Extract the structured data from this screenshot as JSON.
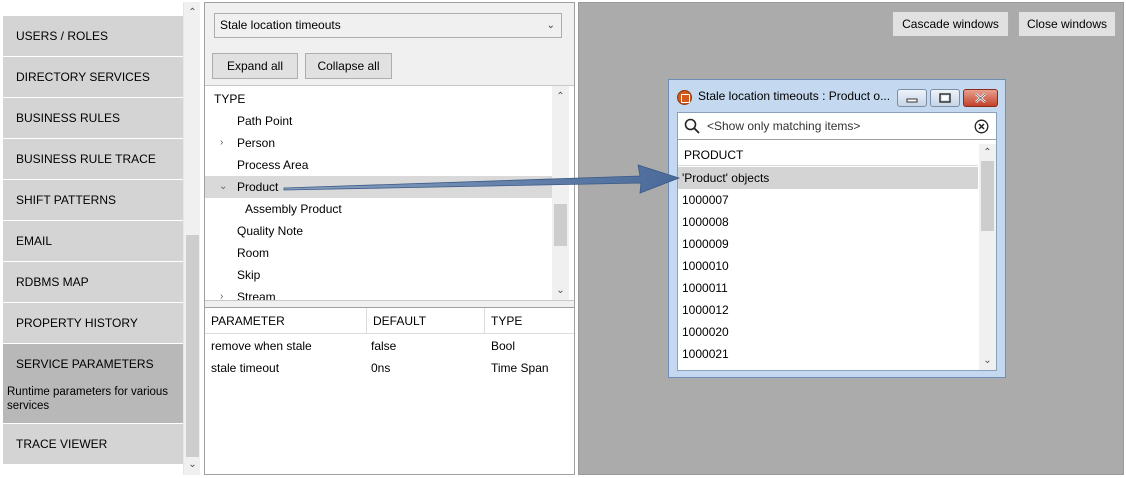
{
  "nav": {
    "items": [
      {
        "label": "USERS / ROLES"
      },
      {
        "label": "DIRECTORY SERVICES"
      },
      {
        "label": "BUSINESS RULES"
      },
      {
        "label": "BUSINESS RULE TRACE"
      },
      {
        "label": "SHIFT PATTERNS"
      },
      {
        "label": "EMAIL"
      },
      {
        "label": "RDBMS MAP"
      },
      {
        "label": "PROPERTY HISTORY"
      },
      {
        "label": "SERVICE PARAMETERS",
        "description": "Runtime parameters for various services"
      },
      {
        "label": "TRACE VIEWER"
      }
    ],
    "selected": "SERVICE PARAMETERS"
  },
  "middle": {
    "combo_value": "Stale location timeouts",
    "expand_all": "Expand all",
    "collapse_all": "Collapse all",
    "tree": {
      "header": "TYPE",
      "items": [
        {
          "label": "Path Point"
        },
        {
          "label": "Person",
          "expandable": true
        },
        {
          "label": "Process Area"
        },
        {
          "label": "Product",
          "expanded": true,
          "highlighted": true
        },
        {
          "label": "Assembly Product"
        },
        {
          "label": "Quality Note"
        },
        {
          "label": "Room"
        },
        {
          "label": "Skip"
        },
        {
          "label": "Stream",
          "expandable": true
        }
      ]
    },
    "params": {
      "columns": [
        "PARAMETER",
        "DEFAULT",
        "TYPE"
      ],
      "rows": [
        [
          "remove when stale",
          "false",
          "Bool"
        ],
        [
          "stale timeout",
          "0ns",
          "Time Span"
        ]
      ]
    }
  },
  "workspace": {
    "cascade": "Cascade windows",
    "close": "Close windows"
  },
  "child_window": {
    "title": "Stale location timeouts : Product o...",
    "search_placeholder": "<Show only matching items>",
    "list_header": "PRODUCT",
    "rows": [
      "'Product' objects",
      "1000007",
      "1000008",
      "1000009",
      "1000010",
      "1000011",
      "1000012",
      "1000020",
      "1000021"
    ],
    "selected_row": "'Product' objects"
  },
  "colors": {
    "nav_bg": "#d4d4d4",
    "nav_selected": "#b8b8b8",
    "workspace_bg": "#ababab",
    "window_frame": "#c4d8ef",
    "arrow": "#4a6a9a",
    "close_button": "#c3422a"
  },
  "icons": [
    "chevron-up-icon",
    "chevron-down-icon",
    "chevron-right-icon",
    "search-icon",
    "clear-icon",
    "app-icon",
    "minimize-icon",
    "restore-icon",
    "close-icon"
  ]
}
